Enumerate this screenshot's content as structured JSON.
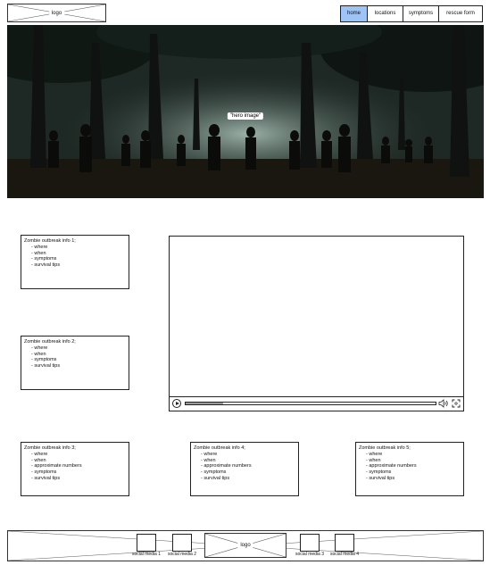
{
  "header": {
    "logo_label": "logo",
    "nav": [
      {
        "label": "home",
        "active": true
      },
      {
        "label": "locations",
        "active": false
      },
      {
        "label": "symptoms",
        "active": false
      },
      {
        "label": "rescue form",
        "active": false
      }
    ]
  },
  "hero": {
    "label": "\"hero image\""
  },
  "info_boxes": [
    {
      "title": "Zombie outbreak info 1;",
      "items": [
        "where",
        "when",
        "symptoms",
        "survival tips"
      ]
    },
    {
      "title": "Zombie outbreak info 2;",
      "items": [
        "where",
        "when",
        "symptoms",
        "survival tips"
      ]
    },
    {
      "title": "Zombie outbreak info 3;",
      "items": [
        "where",
        "when",
        "approximate numbers",
        "symptoms",
        "survival tips"
      ]
    },
    {
      "title": "Zombie outbreak info 4;",
      "items": [
        "where",
        "when",
        "approximate numbers",
        "symptoms",
        "survival tips"
      ]
    },
    {
      "title": "Zombie outbreak info 5;",
      "items": [
        "where",
        "when",
        "approximate numbers",
        "symptoms",
        "survival tips"
      ]
    }
  ],
  "video": {
    "progress": 0.15,
    "icons": [
      "play-icon",
      "volume-icon",
      "fullscreen-icon"
    ]
  },
  "footer": {
    "logo_label": "logo",
    "social": [
      "social media 1",
      "social media 2",
      "social media 3",
      "social media 4"
    ]
  },
  "colors": {
    "active_nav": "#9ec3f5",
    "border": "#222222"
  }
}
